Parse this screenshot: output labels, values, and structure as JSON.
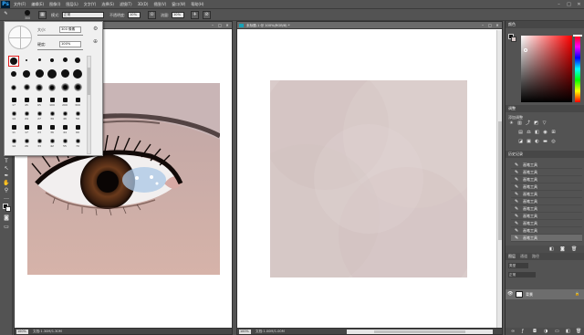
{
  "app": {
    "logo": "Ps"
  },
  "menubar": {
    "items": [
      "文件(F)",
      "编辑(E)",
      "图像(I)",
      "图层(L)",
      "文字(Y)",
      "选择(S)",
      "滤镜(T)",
      "3D(D)",
      "视图(V)",
      "窗口(W)",
      "帮助(H)"
    ]
  },
  "options": {
    "brush_size": "300",
    "mode_label": "模式:",
    "mode_value": "正常",
    "opacity_label": "不透明度:",
    "opacity_value": "10%",
    "flow_label": "流量:",
    "flow_value": "10%"
  },
  "brush_picker": {
    "size_label": "大小:",
    "size_value": "300 像素",
    "hardness_label": "硬度:",
    "hardness_value": "100%",
    "tip_sizes": [
      "1",
      "3",
      "5",
      "9",
      "13",
      "19",
      "5",
      "9",
      "13",
      "17",
      "45",
      "65",
      "100",
      "200",
      "300",
      "9",
      "13",
      "19",
      "17",
      "45",
      "65",
      "100",
      "200",
      "300",
      "14",
      "24",
      "27",
      "39",
      "46",
      "59",
      "11",
      "17",
      "23",
      "36",
      "44",
      "60",
      "14",
      "26",
      "33",
      "42",
      "55",
      "70"
    ]
  },
  "doc1": {
    "title": "",
    "zoom": "100%",
    "status": "文档:1.30M/1.30M"
  },
  "doc2": {
    "title": "未标题-1 @ 100%(RGB/8) *",
    "zoom": "100%",
    "status": "文档:1.00M/1.00M"
  },
  "panels": {
    "color_tab": "颜色",
    "adjustments_tab": "调整",
    "adjustments_hint": "添加调整",
    "history_tab": "历史记录",
    "history_items": [
      "画笔工具",
      "画笔工具",
      "画笔工具",
      "画笔工具",
      "画笔工具",
      "画笔工具",
      "画笔工具",
      "画笔工具",
      "画笔工具",
      "画笔工具",
      "画笔工具"
    ],
    "layers_tabs": [
      "图层",
      "通道",
      "路径"
    ],
    "layer_kind": "类型",
    "layer_blend": "正常",
    "layer_name": "背景"
  },
  "colors": {
    "canvas_fill": "#d9cbca",
    "hue_red": "#ff0000",
    "accent_selected": "#e02020"
  }
}
